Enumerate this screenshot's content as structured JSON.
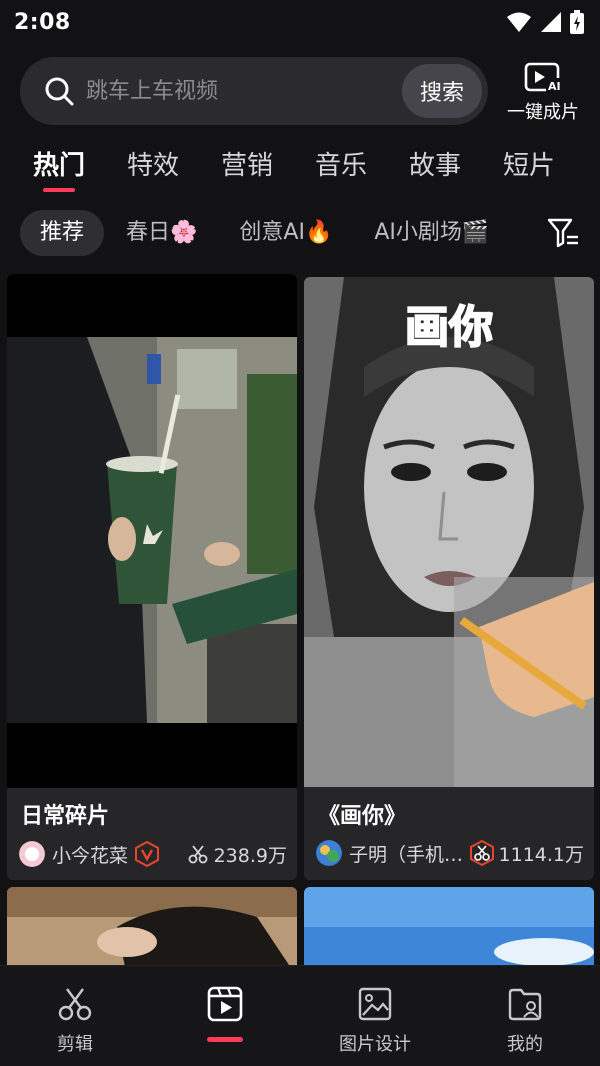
{
  "status_bar": {
    "time": "2:08"
  },
  "search": {
    "placeholder": "跳车上车视频",
    "button_label": "搜索"
  },
  "oneclick": {
    "label": "一键成片"
  },
  "main_tabs": [
    {
      "label": "热门",
      "active": true
    },
    {
      "label": "特效"
    },
    {
      "label": "营销"
    },
    {
      "label": "音乐"
    },
    {
      "label": "故事"
    },
    {
      "label": "短片"
    }
  ],
  "sub_tabs": [
    {
      "label": "推荐",
      "active": true
    },
    {
      "label": "春日🌸"
    },
    {
      "label": "创意AI🔥"
    },
    {
      "label": "AI小剧场🎬"
    }
  ],
  "cards": [
    {
      "title": "日常碎片",
      "author": "小今花菜",
      "uses": "238.9万"
    },
    {
      "title": "《画你》",
      "author": "子明（手机…",
      "uses": "1114.1万",
      "overlay_text": "画你"
    }
  ],
  "bottom_nav": [
    {
      "label": "剪辑",
      "icon": "scissors-icon"
    },
    {
      "label": "",
      "icon": "template-play-icon",
      "active": true
    },
    {
      "label": "图片设计",
      "icon": "image-icon"
    },
    {
      "label": "我的",
      "icon": "profile-folder-icon"
    }
  ],
  "colors": {
    "accent": "#ff3b5c",
    "background": "#121214",
    "card": "#262629",
    "badge": "#e8452f"
  }
}
